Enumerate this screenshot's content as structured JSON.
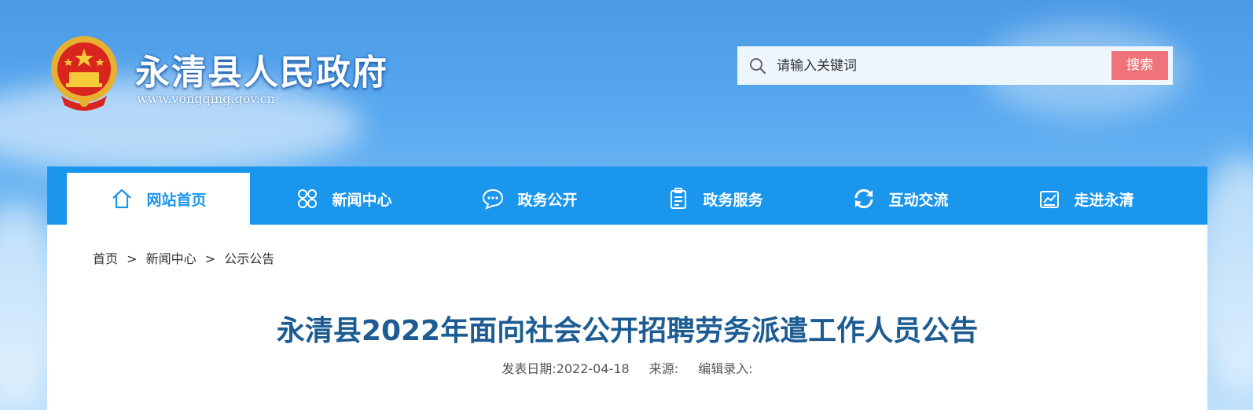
{
  "site": {
    "title": "永清县人民政府",
    "url": "www.yongqing.gov.cn"
  },
  "search": {
    "placeholder": "请输入关键词",
    "button_label": "搜索"
  },
  "nav": {
    "items": [
      {
        "label": "网站首页",
        "icon": "home-icon"
      },
      {
        "label": "新闻中心",
        "icon": "grid-icon"
      },
      {
        "label": "政务公开",
        "icon": "chat-icon"
      },
      {
        "label": "政务服务",
        "icon": "clipboard-icon"
      },
      {
        "label": "互动交流",
        "icon": "refresh-icon"
      },
      {
        "label": "走进永清",
        "icon": "chart-icon"
      }
    ],
    "active_index": 0
  },
  "breadcrumb": {
    "items": [
      "首页",
      "新闻中心",
      "公示公告"
    ],
    "separator": ">"
  },
  "article": {
    "title": "永清县2022年面向社会公开招聘劳务派遣工作人员公告",
    "date_label": "发表日期:2022-04-18",
    "source_label": "来源:",
    "editor_label": "编辑录入:"
  },
  "colors": {
    "nav_bg": "#1a96ec",
    "search_button": "#f0727a",
    "title": "#1c5c93"
  }
}
